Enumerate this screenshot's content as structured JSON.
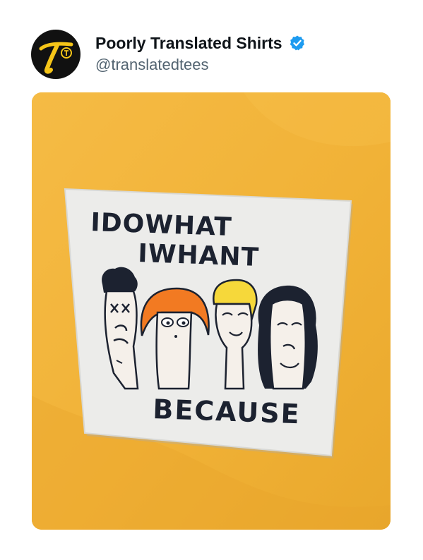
{
  "account": {
    "display_name": "Poorly Translated Shirts",
    "handle": "@translatedtees",
    "avatar_icon": "t-monogram-logo",
    "verified_icon": "verified-badge-icon",
    "verified_color": "#1d9bf0"
  },
  "media": {
    "shirt_color": "#f2b53a",
    "patch": {
      "line1": "IDOWHAT",
      "line2": "IWHANT",
      "line3": "BECAUSE"
    },
    "figures": [
      "dark-haired-face-figure",
      "orange-haired-face-figure",
      "blonde-haired-face-figure",
      "curly-haired-face-figure"
    ]
  }
}
